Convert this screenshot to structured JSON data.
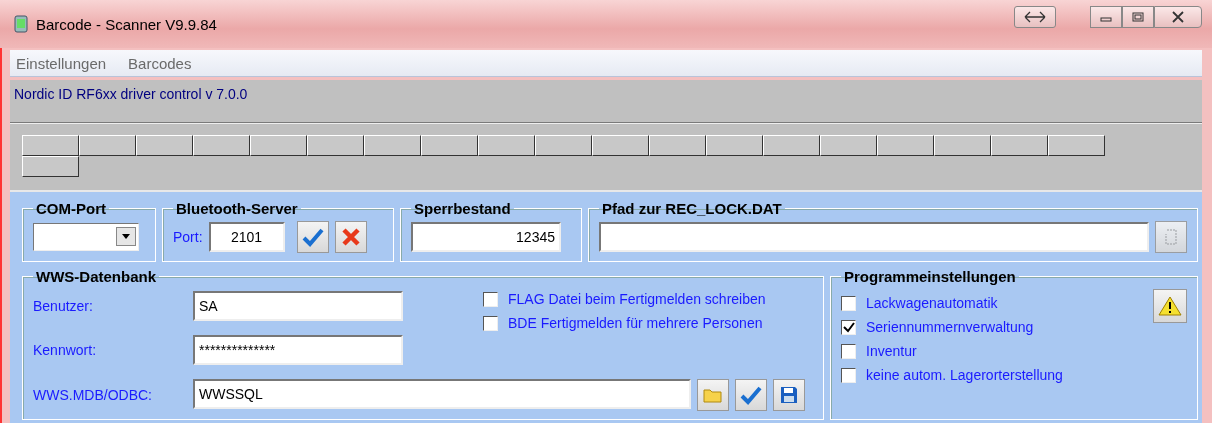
{
  "window": {
    "title": "Barcode - Scanner V9.9.84"
  },
  "menu": [
    {
      "label": "Einstellungen"
    },
    {
      "label": "Barcodes"
    }
  ],
  "status": {
    "text": "Nordic ID RF6xx driver control v 7.0.0"
  },
  "function_keys": [
    {
      "kind": "blank"
    },
    {
      "kind": "blank"
    },
    {
      "kind": "blank"
    },
    {
      "kind": "blank"
    },
    {
      "kind": "blank"
    },
    {
      "kind": "blank"
    },
    {
      "kind": "blank"
    },
    {
      "kind": "blank"
    },
    {
      "kind": "blank"
    },
    {
      "kind": "blank"
    },
    {
      "kind": "blank"
    },
    {
      "kind": "blank"
    },
    {
      "kind": "blank"
    },
    {
      "kind": "blank"
    },
    {
      "kind": "blank"
    },
    {
      "kind": "blank"
    },
    {
      "kind": "blank"
    },
    {
      "kind": "blank"
    },
    {
      "kind": "blank"
    },
    {
      "kind": "blank"
    }
  ],
  "com_port": {
    "title": "COM-Port"
  },
  "bluetooth": {
    "title": "Bluetooth-Server",
    "port_label": "Port:",
    "port": "2101"
  },
  "stock_lock": {
    "title": "Sperrbestand",
    "value": "12345"
  },
  "lock_path": {
    "title": "Pfad zur REC_LOCK.DAT"
  },
  "database": {
    "title": "WWS-Datenbank",
    "fields": [
      {
        "label": "Benutzer:",
        "value": "SA"
      },
      {
        "label": "Kennwort:",
        "value": "**************"
      },
      {
        "label": "WWS.MDB/ODBC:",
        "value": "WWSSQL"
      }
    ],
    "options": [
      {
        "label": "FLAG Datei beim Fertigmelden schreiben",
        "checked": false
      },
      {
        "label": "BDE Fertigmelden für mehrere Personen",
        "checked": false
      }
    ]
  },
  "program_settings": {
    "title": "Programmeinstellungen",
    "options": [
      {
        "label": "Lackwagenautomatik",
        "checked": false
      },
      {
        "label": "Seriennummernverwaltung",
        "checked": true
      },
      {
        "label": "Inventur",
        "checked": false
      },
      {
        "label": "keine autom. Lagerorterstellung",
        "checked": false
      }
    ]
  }
}
